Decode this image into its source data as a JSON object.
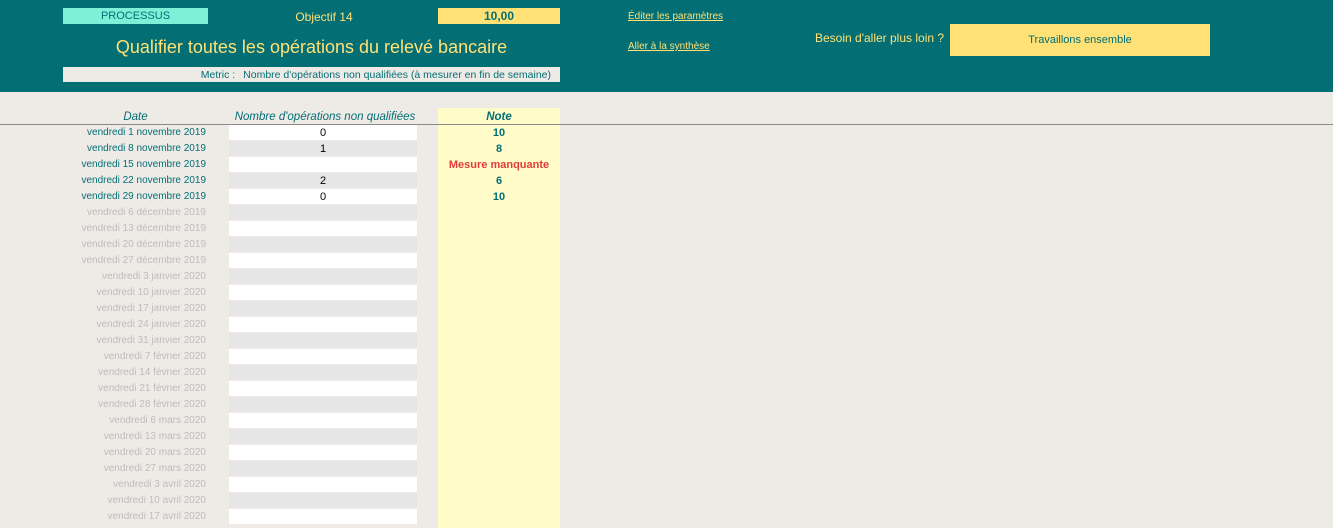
{
  "header": {
    "badge": "PROCESSUS",
    "objective": "Objectif 14",
    "score": "10,00",
    "title": "Qualifier toutes les opérations du relevé bancaire",
    "metric_label": "Metric :",
    "metric_value": "Nombre d'opérations non qualifiées (à mesurer en fin de semaine)",
    "edit_link": "Éditer les paramètres",
    "synth_link": "Aller à la synthèse",
    "help_label": "Besoin d'aller plus loin ?",
    "cta": "Travaillons ensemble"
  },
  "table": {
    "columns": {
      "date": "Date",
      "count": "Nombre d'opérations non qualifiées",
      "note": "Note"
    },
    "rows": [
      {
        "date": "vendredi 1 novembre 2019",
        "count": "0",
        "note": "10",
        "active": true
      },
      {
        "date": "vendredi 8 novembre 2019",
        "count": "1",
        "note": "8",
        "active": true
      },
      {
        "date": "vendredi 15 novembre 2019",
        "count": "",
        "note": "Mesure manquante",
        "active": true,
        "missing": true
      },
      {
        "date": "vendredi 22 novembre 2019",
        "count": "2",
        "note": "6",
        "active": true
      },
      {
        "date": "vendredi 29 novembre 2019",
        "count": "0",
        "note": "10",
        "active": true
      },
      {
        "date": "vendredi 6 décembre 2019",
        "count": "",
        "note": ""
      },
      {
        "date": "vendredi 13 décembre 2019",
        "count": "",
        "note": ""
      },
      {
        "date": "vendredi 20 décembre 2019",
        "count": "",
        "note": ""
      },
      {
        "date": "vendredi 27 décembre 2019",
        "count": "",
        "note": ""
      },
      {
        "date": "vendredi 3 janvier 2020",
        "count": "",
        "note": ""
      },
      {
        "date": "vendredi 10 janvier 2020",
        "count": "",
        "note": ""
      },
      {
        "date": "vendredi 17 janvier 2020",
        "count": "",
        "note": ""
      },
      {
        "date": "vendredi 24 janvier 2020",
        "count": "",
        "note": ""
      },
      {
        "date": "vendredi 31 janvier 2020",
        "count": "",
        "note": ""
      },
      {
        "date": "vendredi 7 février 2020",
        "count": "",
        "note": ""
      },
      {
        "date": "vendredi 14 février 2020",
        "count": "",
        "note": ""
      },
      {
        "date": "vendredi 21 février 2020",
        "count": "",
        "note": ""
      },
      {
        "date": "vendredi 28 février 2020",
        "count": "",
        "note": ""
      },
      {
        "date": "vendredi 6 mars 2020",
        "count": "",
        "note": ""
      },
      {
        "date": "vendredi 13 mars 2020",
        "count": "",
        "note": ""
      },
      {
        "date": "vendredi 20 mars 2020",
        "count": "",
        "note": ""
      },
      {
        "date": "vendredi 27 mars 2020",
        "count": "",
        "note": ""
      },
      {
        "date": "vendredi 3 avril 2020",
        "count": "",
        "note": ""
      },
      {
        "date": "vendredi 10 avril 2020",
        "count": "",
        "note": ""
      },
      {
        "date": "vendredi 17 avril 2020",
        "count": "",
        "note": ""
      }
    ]
  },
  "colors": {
    "header_bg": "#036e74",
    "accent_yellow": "#ffe176",
    "badge_bg": "#7cf1d7",
    "note_col_bg": "#fffcc9",
    "missing_red": "#e23b3b"
  }
}
